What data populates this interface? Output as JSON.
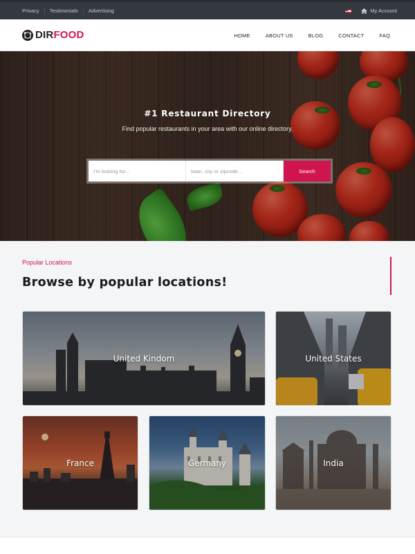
{
  "topbar": {
    "links": [
      "Privacy",
      "Testimonials",
      "Advertising"
    ],
    "account_label": "My Account"
  },
  "header": {
    "logo_dark": "DIR",
    "logo_accent": "FOOD",
    "nav": [
      "HOME",
      "ABOUT US",
      "BLOG",
      "CONTACT",
      "FAQ"
    ]
  },
  "hero": {
    "title": "#1 Restaurant Directory",
    "subtitle": "Find popular restaurants in your area with our online directory.",
    "search": {
      "keyword_placeholder": "I'm looking for...",
      "location_placeholder": "town, city or zipcode...",
      "button_label": "Search"
    }
  },
  "locations": {
    "eyebrow": "Popular Locations",
    "heading": "Browse by popular locations!",
    "cards": [
      "United Kindom",
      "United States",
      "France",
      "Germany",
      "India"
    ]
  },
  "colors": {
    "brand": "#d0144f",
    "topbar": "#34393f"
  }
}
